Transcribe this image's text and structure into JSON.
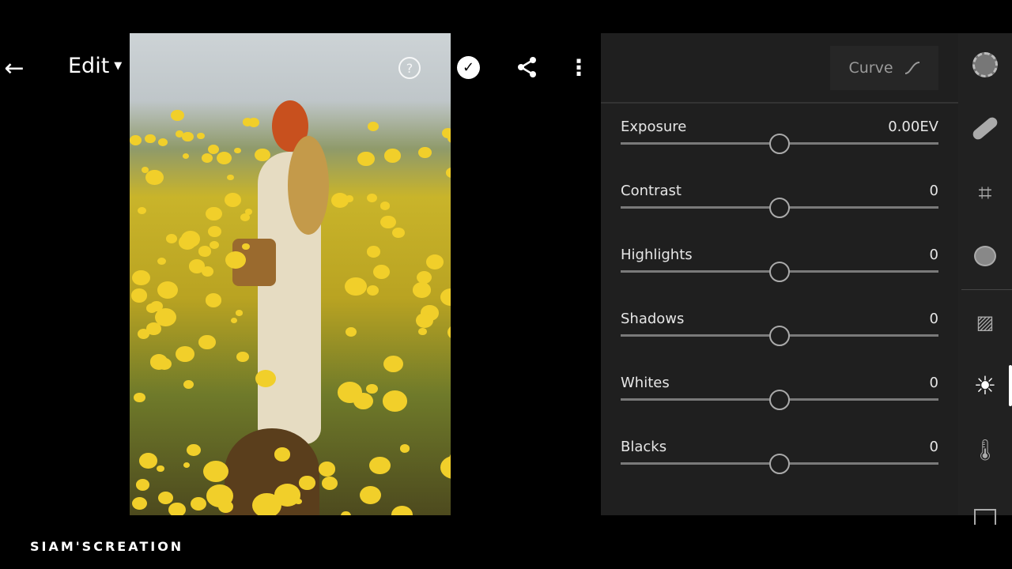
{
  "header": {
    "title": "Edit"
  },
  "panel": {
    "curve_label": "Curve",
    "sliders": [
      {
        "label": "Exposure",
        "value": "0.00EV",
        "position": 0.5
      },
      {
        "label": "Contrast",
        "value": "0",
        "position": 0.5
      },
      {
        "label": "Highlights",
        "value": "0",
        "position": 0.5
      },
      {
        "label": "Shadows",
        "value": "0",
        "position": 0.5
      },
      {
        "label": "Whites",
        "value": "0",
        "position": 0.5
      },
      {
        "label": "Blacks",
        "value": "0",
        "position": 0.5
      }
    ]
  },
  "tools": [
    "selective-icon",
    "healing-icon",
    "crop-icon",
    "profile-icon",
    "auto-icon",
    "light-icon",
    "color-temperature-icon",
    "effects-icon"
  ],
  "watermark": "SIAM'SCREATION"
}
